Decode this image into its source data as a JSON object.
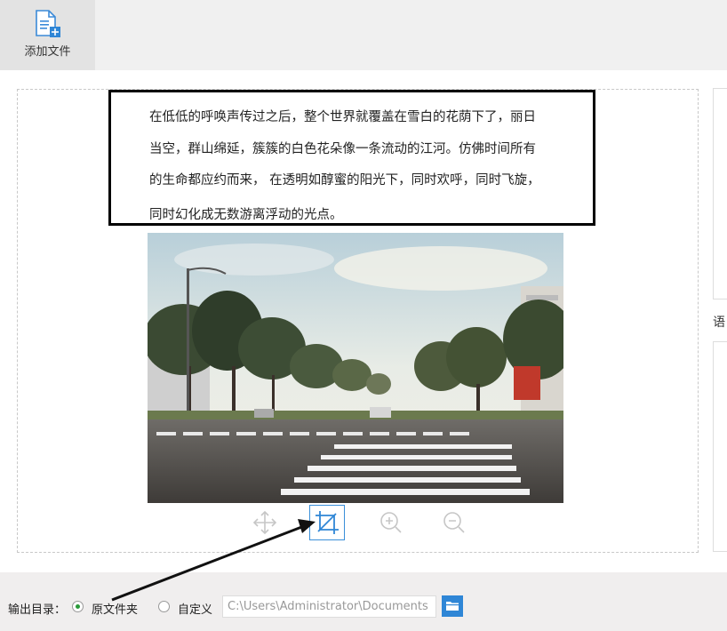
{
  "toolbar": {
    "add_file_label": "添加文件"
  },
  "document": {
    "lines": [
      "在低低的呼唤声传过之后，整个世界就覆盖在雪白的花荫下了，丽日",
      "当空，群山绵延，簇簇的白色花朵像一条流动的江河。仿佛时间所有",
      "的生命都应约而来， 在透明如醇蜜的阳光下，同时欢呼，同时飞旋，",
      "同时幻化成无数游离浮动的光点。"
    ]
  },
  "side": {
    "language_label": "语"
  },
  "image_tools": [
    "move-icon",
    "crop-icon",
    "zoom-in-icon",
    "zoom-out-icon"
  ],
  "output": {
    "label": "输出目录：",
    "option_original": "原文件夹",
    "option_custom": "自定义",
    "path_value": "C:\\Users\\Administrator\\Documents",
    "selected": "original"
  },
  "colors": {
    "accent": "#2f86d6",
    "radio_checked": "#2a9a3a"
  }
}
